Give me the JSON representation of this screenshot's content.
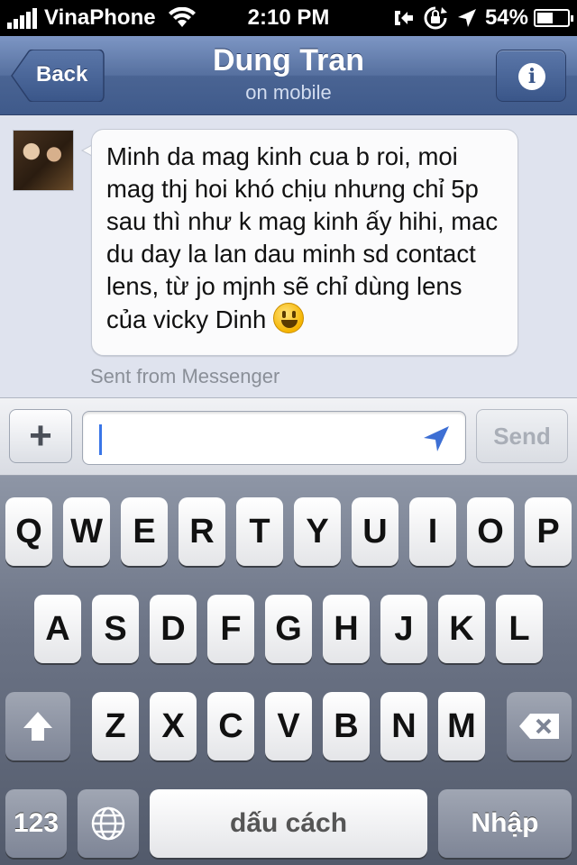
{
  "status_bar": {
    "carrier": "VinaPhone",
    "time": "2:10 PM",
    "battery_percent_label": "54%",
    "battery_level": 0.54
  },
  "nav": {
    "back_label": "Back",
    "title": "Dung Tran",
    "subtitle": "on mobile",
    "info_icon": "info-icon"
  },
  "message": {
    "text": "Minh da mag kinh cua b roi, moi mag thj hoi khó chịu nhưng chỉ 5p sau thì như k mag kinh ấy hihi, mac du day la lan dau minh sd contact lens, từ jo mjnh sẽ chỉ dùng lens của vicky Dinh",
    "emoji": "smiley-emoji",
    "footer": "Sent from Messenger"
  },
  "compose": {
    "plus_label": "+",
    "input_value": "",
    "send_label": "Send"
  },
  "keyboard": {
    "row1": [
      "Q",
      "W",
      "E",
      "R",
      "T",
      "Y",
      "U",
      "I",
      "O",
      "P"
    ],
    "row2": [
      "A",
      "S",
      "D",
      "F",
      "G",
      "H",
      "J",
      "K",
      "L"
    ],
    "row3": [
      "Z",
      "X",
      "C",
      "V",
      "B",
      "N",
      "M"
    ],
    "numbers_label": "123",
    "space_label": "dấu cách",
    "return_label": "Nhập"
  }
}
